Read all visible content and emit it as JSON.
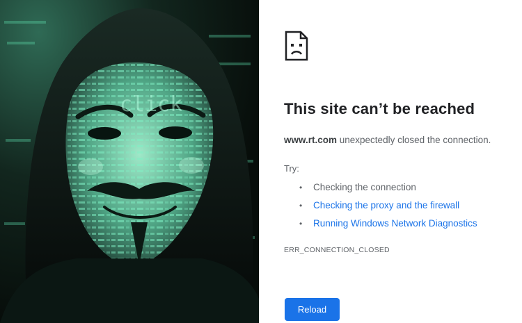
{
  "photo": {
    "alt": "Hooded person wearing a Guy Fawkes mask lit by green code",
    "overlay_text": "click",
    "accent": "#3fd6a0"
  },
  "error_page": {
    "icon": "sad-page-icon",
    "title": "This site can’t be reached",
    "domain": "www.rt.com",
    "message_suffix": " unexpectedly closed the connection.",
    "try_label": "Try:",
    "suggestions": [
      {
        "label": "Checking the connection",
        "link": false
      },
      {
        "label": "Checking the proxy and the firewall",
        "link": true
      },
      {
        "label": "Running Windows Network Diagnostics",
        "link": true
      }
    ],
    "error_code": "ERR_CONNECTION_CLOSED",
    "reload_label": "Reload",
    "colors": {
      "link": "#1a73e8",
      "button": "#1a73e8",
      "text": "#202124",
      "muted": "#5f6368"
    }
  }
}
